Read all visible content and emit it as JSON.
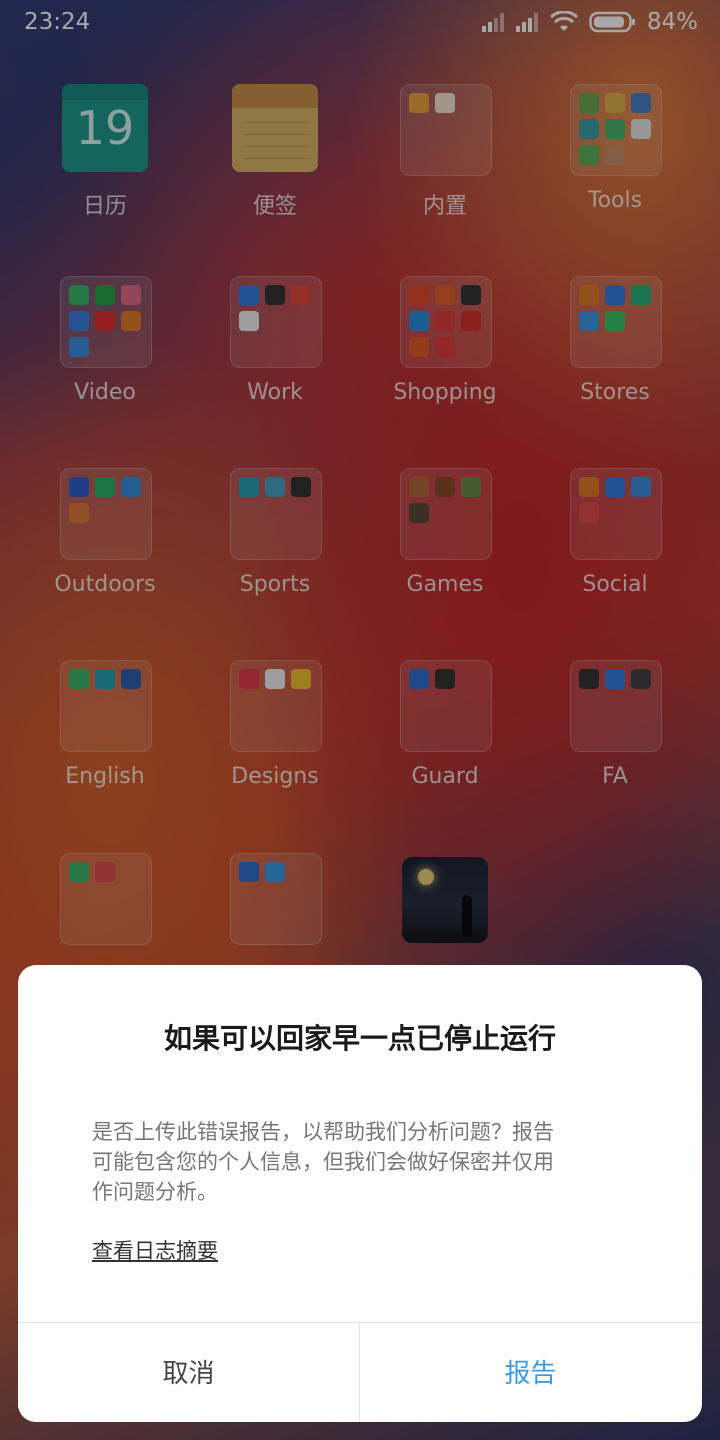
{
  "status_bar": {
    "time": "23:24",
    "battery_percent": "84%"
  },
  "apps": [
    {
      "label": "日历",
      "type": "calendar",
      "day": "19"
    },
    {
      "label": "便签",
      "type": "notes"
    },
    {
      "label": "内置",
      "type": "folder",
      "colors": [
        "#e9a33b",
        "#f0e6d2"
      ]
    },
    {
      "label": "Tools",
      "type": "folder",
      "colors": [
        "#6aa84f",
        "#e0b04a",
        "#4a7fc1",
        "#3aa1a8",
        "#4bb36b",
        "#e6e6e6",
        "#5db35c",
        "#c98d6a"
      ]
    },
    {
      "label": "Video",
      "type": "folder",
      "colors": [
        "#3ab56a",
        "#2aa14f",
        "#e06a8c",
        "#3a7ee0",
        "#e03030",
        "#e07a2a",
        "#3a8ee0"
      ]
    },
    {
      "label": "Work",
      "type": "folder",
      "colors": [
        "#2f7de0",
        "#333333",
        "#e04a3a",
        "#f0f0f0"
      ]
    },
    {
      "label": "Shopping",
      "type": "folder",
      "colors": [
        "#e04a2a",
        "#e0602a",
        "#333333",
        "#2a8ee0",
        "#e03a3a",
        "#d03030",
        "#e05a2a",
        "#e03a3a"
      ]
    },
    {
      "label": "Stores",
      "type": "folder",
      "colors": [
        "#e07a2a",
        "#2f7de0",
        "#2ab07a",
        "#3a9ae0",
        "#3ac46a"
      ]
    },
    {
      "label": "Outdoors",
      "type": "folder",
      "colors": [
        "#2f5fd0",
        "#2ab06a",
        "#3a8ee0",
        "#e07a3a"
      ]
    },
    {
      "label": "Sports",
      "type": "folder",
      "colors": [
        "#2aa0b0",
        "#4aa0c0",
        "#333333"
      ]
    },
    {
      "label": "Games",
      "type": "folder",
      "colors": [
        "#b06a3a",
        "#8a4a2a",
        "#6a8a4a",
        "#5a4a3a"
      ]
    },
    {
      "label": "Social",
      "type": "folder",
      "colors": [
        "#e07a2a",
        "#2f7de0",
        "#3a8ee0",
        "#e04a4a"
      ]
    },
    {
      "label": "English",
      "type": "folder",
      "colors": [
        "#3ab56a",
        "#2aa0b0",
        "#2f5fb0"
      ]
    },
    {
      "label": "Designs",
      "type": "folder",
      "colors": [
        "#e03a4a",
        "#f0f0f0",
        "#f0c030"
      ]
    },
    {
      "label": "Guard",
      "type": "folder",
      "colors": [
        "#2f6fd0",
        "#333333"
      ]
    },
    {
      "label": "FA",
      "type": "folder",
      "colors": [
        "#333333",
        "#2f7de0",
        "#444444"
      ]
    },
    {
      "label": "",
      "type": "folder",
      "colors": [
        "#3ab56a",
        "#e04a4a"
      ]
    },
    {
      "label": "",
      "type": "folder",
      "colors": [
        "#2f6fd0",
        "#3a9ae0"
      ]
    },
    {
      "label": "",
      "type": "game"
    }
  ],
  "dialog": {
    "title": "如果可以回家早一点已停止运行",
    "message": "是否上传此错误报告，以帮助我们分析问题？报告可能包含您的个人信息，但我们会做好保密并仅用作问题分析。",
    "log_link": "查看日志摘要",
    "cancel_label": "取消",
    "report_label": "报告"
  },
  "colors": {
    "accent_blue": "#3a9ae8"
  }
}
